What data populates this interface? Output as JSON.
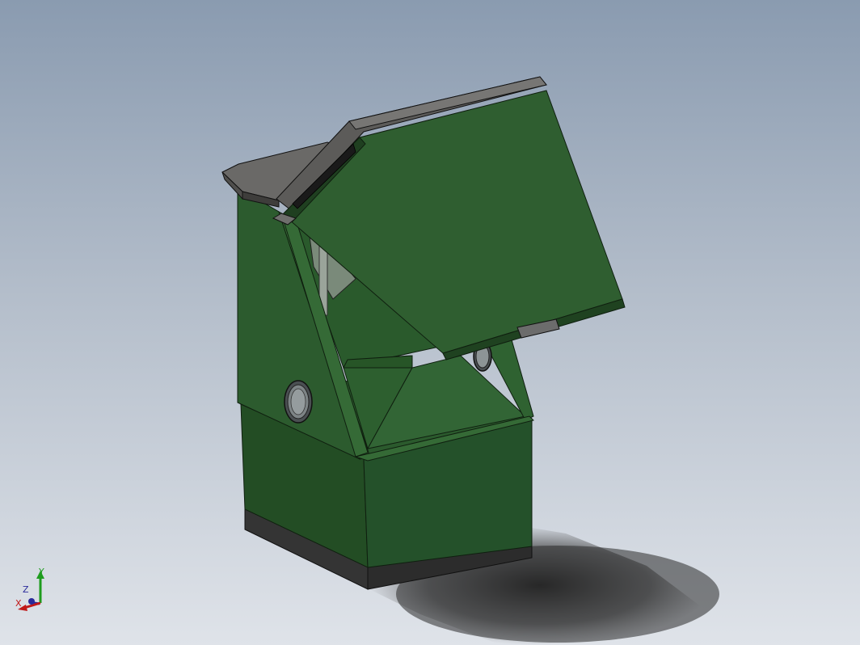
{
  "viewport": {
    "background_top": "#8a9bb0",
    "background_bottom": "#dfe3e9"
  },
  "model": {
    "body_color": "#2d5e2f",
    "roof_color": "#6b6b69",
    "base_color": "#3a3a3a"
  },
  "triad": {
    "axis_y_label": "Y",
    "axis_z_label": "Z",
    "axis_x_label": "X",
    "axis_y_color": "#1e9c1e",
    "axis_z_color": "#2a2a9a",
    "axis_x_color": "#c01818"
  }
}
